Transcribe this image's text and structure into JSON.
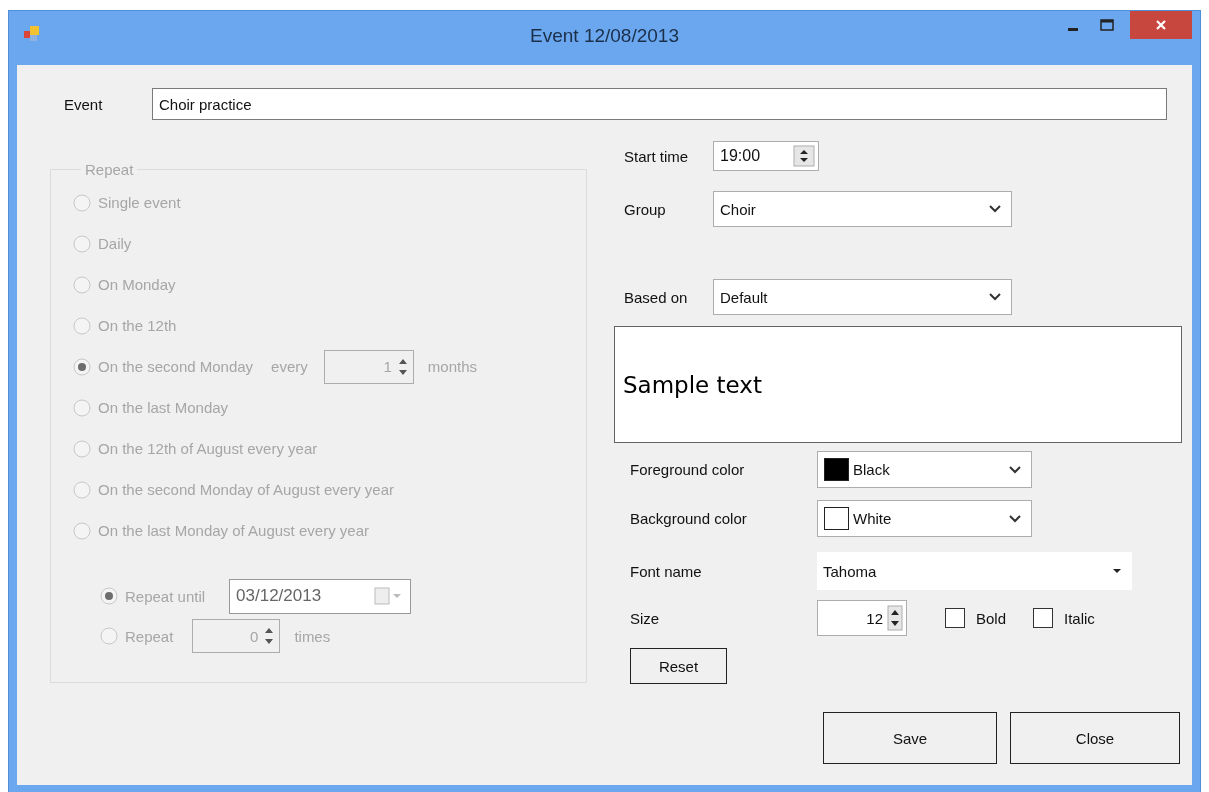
{
  "window": {
    "title": "Event 12/08/2013"
  },
  "event": {
    "label": "Event",
    "value": "Choir practice"
  },
  "repeat": {
    "title": "Repeat",
    "disabled": true,
    "options": [
      {
        "label": "Single event",
        "selected": false
      },
      {
        "label": "Daily",
        "selected": false
      },
      {
        "label": "On Monday",
        "selected": false
      },
      {
        "label": "On the 12th",
        "selected": false
      },
      {
        "label": "On the second Monday",
        "selected": true,
        "every": {
          "label": "every",
          "value": "1",
          "unit": "months"
        }
      },
      {
        "label": "On the last Monday",
        "selected": false
      },
      {
        "label": "On the 12th of August every year",
        "selected": false
      },
      {
        "label": "On the second Monday of August every year",
        "selected": false
      },
      {
        "label": "On the last Monday of August every year",
        "selected": false
      }
    ],
    "end": [
      {
        "kind": "date",
        "label": "Repeat until",
        "selected": true,
        "value": "03/12/2013"
      },
      {
        "kind": "count",
        "label": "Repeat",
        "selected": false,
        "value": "0",
        "unit": "times"
      }
    ]
  },
  "start_time": {
    "label": "Start time",
    "value": "19:00"
  },
  "group": {
    "label": "Group",
    "value": "Choir"
  },
  "based_on": {
    "label": "Based on",
    "value": "Default"
  },
  "sample": {
    "text": "Sample text"
  },
  "colors": [
    {
      "label": "Foreground color",
      "value": "Black",
      "color": "#000000"
    },
    {
      "label": "Background color",
      "value": "White",
      "color": "#ffffff"
    }
  ],
  "font_name": {
    "label": "Font name",
    "value": "Tahoma"
  },
  "size": {
    "label": "Size",
    "value": "12"
  },
  "styles": [
    {
      "label": "Bold",
      "checked": false
    },
    {
      "label": "Italic",
      "checked": false
    }
  ],
  "reset": "Reset",
  "buttons": [
    "Save",
    "Close"
  ]
}
